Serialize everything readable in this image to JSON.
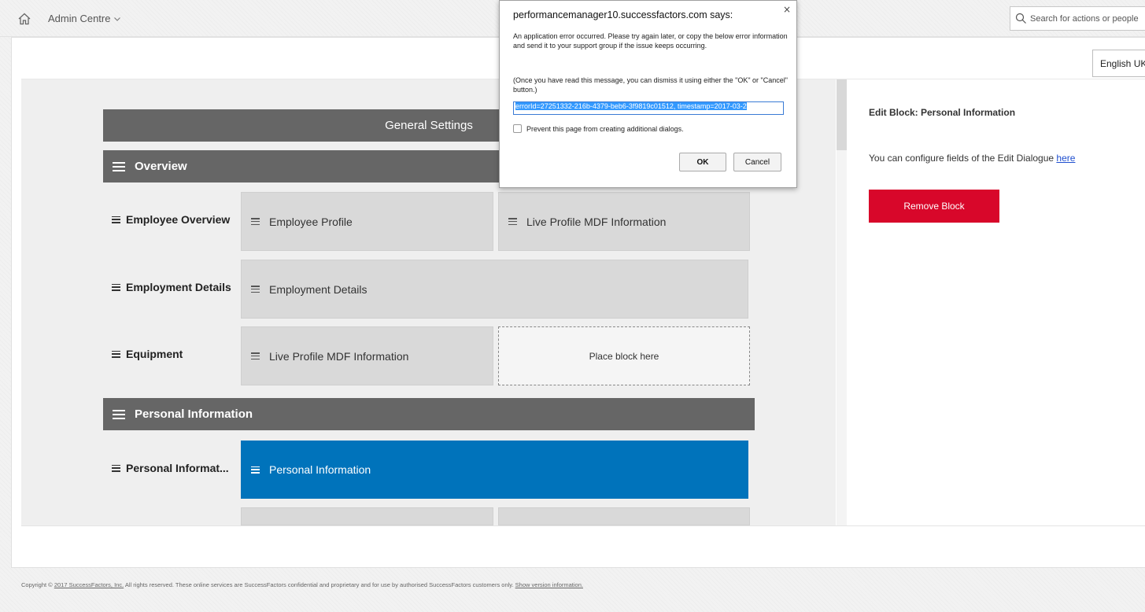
{
  "topbar": {
    "nav_label": "Admin Centre",
    "search_placeholder": "Search for actions or people"
  },
  "language": {
    "selected": "English UK"
  },
  "canvas": {
    "general_settings": "General Settings",
    "sections": [
      {
        "title": "Overview",
        "rows": [
          {
            "label": "Employee Overview",
            "blocks": [
              "Employee Profile",
              "Live Profile MDF Information"
            ]
          },
          {
            "label": "Employment Details",
            "blocks": [
              "Employment Details"
            ]
          },
          {
            "label": "Equipment",
            "blocks": [
              "Live Profile MDF Information"
            ],
            "placeholder": "Place block here"
          }
        ]
      },
      {
        "title": "Personal Information",
        "rows": [
          {
            "label": "Personal Informat...",
            "blocks": [
              "Personal Information"
            ],
            "selected": true
          }
        ]
      }
    ]
  },
  "right_panel": {
    "title": "Edit Block: Personal Information",
    "configure_text": "You can configure fields of the Edit Dialogue",
    "configure_link": "here",
    "remove_button": "Remove Block"
  },
  "dialog": {
    "title": "performancemanager10.successfactors.com says:",
    "message": "An application error occurred. Please try again later, or copy the below error information and send it to   your support group if the issue keeps occurring.",
    "dismiss_note": "(Once you have read this message, you can dismiss it using either the \"OK\" or \"Cancel\" button.)",
    "error_value": "errorId=27251332-216b-4379-beb6-3f9819c01512, timestamp=2017-03-2",
    "prevent_label": "Prevent this page from creating additional dialogs.",
    "ok_label": "OK",
    "cancel_label": "Cancel",
    "close_glyph": "×"
  },
  "footer": {
    "copyright_prefix": "Copyright ©",
    "copyright_link": "2017 SuccessFactors, Inc.",
    "copyright_body": "All rights reserved. These online services are SuccessFactors confidential and proprietary and for use by authorised SuccessFactors customers only.",
    "version_link": "Show version information."
  },
  "colors": {
    "accent_blue": "#0073bb",
    "remove_red": "#d8072a",
    "section_grey": "#666666"
  }
}
